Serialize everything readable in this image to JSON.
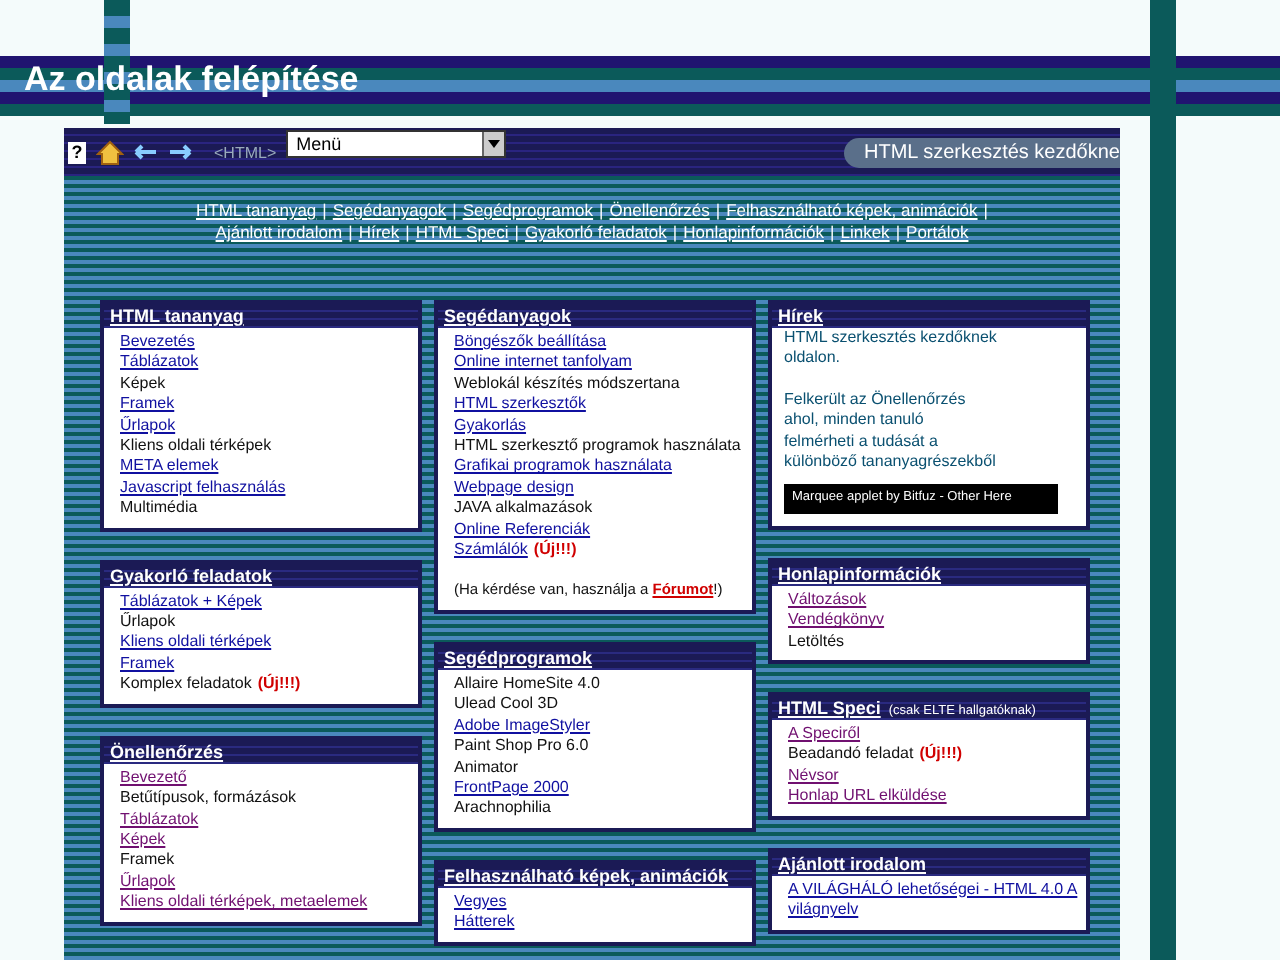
{
  "page_title": "Az oldalak felépítése",
  "toolbar": {
    "help_glyph": "?",
    "html_tag": "<HTML>",
    "menu_select": {
      "value": "Menü"
    },
    "site_title": "HTML szerkesztés kezdőkne"
  },
  "nav_separator": "|",
  "nav_lines": [
    [
      "HTML tananyag",
      "Segédanyagok",
      "Segédprogramok",
      "Önellenőrzés",
      "Felhasználható képek, animációk"
    ],
    [
      "Ajánlott irodalom",
      "Hírek",
      "HTML Speci",
      "Gyakorló feladatok",
      "Honlapinformációk",
      "Linkek",
      "Portálok"
    ]
  ],
  "columns": [
    [
      {
        "kind": "links",
        "title": "HTML tananyag",
        "visited": false,
        "items": [
          {
            "text": "Bevezetés",
            "link": true
          },
          {
            "text": "Táblázatok",
            "link": true
          },
          {
            "text": "Képek",
            "link": false
          },
          {
            "text": "Framek",
            "link": true
          },
          {
            "text": "Űrlapok",
            "link": true
          },
          {
            "text": "Kliens oldali térképek",
            "link": false
          },
          {
            "text": "META elemek",
            "link": true
          },
          {
            "text": "Javascript felhasználás",
            "link": true
          },
          {
            "text": "Multimédia",
            "link": false
          }
        ]
      },
      {
        "kind": "links",
        "title": "Gyakorló feladatok",
        "visited": false,
        "items": [
          {
            "text": "Táblázatok + Képek",
            "link": true
          },
          {
            "text": "Űrlapok",
            "link": false
          },
          {
            "text": "Kliens oldali térképek",
            "link": true
          },
          {
            "text": "Framek",
            "link": true
          },
          {
            "text": "Komplex feladatok",
            "link": false,
            "badge": "(Új!!!)"
          }
        ]
      },
      {
        "kind": "links",
        "title": "Önellenőrzés",
        "visited": true,
        "items": [
          {
            "text": "Bevezető",
            "link": true
          },
          {
            "text": "Betűtípusok, formázások",
            "link": false
          },
          {
            "text": "Táblázatok",
            "link": true
          },
          {
            "text": "Képek",
            "link": true
          },
          {
            "text": "Framek",
            "link": false
          },
          {
            "text": "Űrlapok",
            "link": true
          },
          {
            "text": "Kliens oldali térképek, metaelemek",
            "link": true
          }
        ]
      }
    ],
    [
      {
        "kind": "links",
        "title": "Segédanyagok",
        "visited": false,
        "items": [
          {
            "text": "Böngészők beállítása",
            "link": true
          },
          {
            "text": "Online internet tanfolyam",
            "link": true
          },
          {
            "text": "Weblokál készítés módszertana",
            "link": false
          },
          {
            "text": "HTML szerkesztők",
            "link": true
          },
          {
            "text": "Gyakorlás",
            "link": true
          },
          {
            "text": "HTML szerkesztő programok használata",
            "link": false
          },
          {
            "text": "Grafikai programok használata",
            "link": true
          },
          {
            "text": "Webpage design",
            "link": true
          },
          {
            "text": "JAVA alkalmazások",
            "link": false
          },
          {
            "text": "Online Referenciák",
            "link": true
          },
          {
            "text": "Számlálók",
            "link": true,
            "badge": "(Új!!!)"
          }
        ],
        "note": {
          "before": "(Ha kérdése van, használja a ",
          "link": "Fórumot",
          "after": "!)"
        }
      },
      {
        "kind": "links",
        "title": "Segédprogramok",
        "visited": false,
        "items": [
          {
            "text": "Allaire HomeSite 4.0",
            "link": false
          },
          {
            "text": "Ulead Cool 3D",
            "link": false
          },
          {
            "text": "Adobe ImageStyler",
            "link": true
          },
          {
            "text": "Paint Shop Pro 6.0",
            "link": false
          },
          {
            "text": "Animator",
            "link": false
          },
          {
            "text": "FrontPage 2000",
            "link": true
          },
          {
            "text": "Arachnophilia",
            "link": false
          }
        ]
      },
      {
        "kind": "links",
        "title": "Felhasználható képek, animációk",
        "visited": false,
        "items": [
          {
            "text": "Vegyes",
            "link": true
          },
          {
            "text": "Hátterek",
            "link": true
          }
        ]
      }
    ],
    [
      {
        "kind": "news",
        "title": "Hírek",
        "paragraphs": [
          [
            "HTML szerkesztés kezdőknek",
            "oldalon."
          ],
          [
            "Felkerült az Önellenőrzés",
            "ahol, minden tanuló",
            "felmérheti a tudását a",
            "különböző tananyagrészekből"
          ]
        ],
        "credit": "Marquee applet by Bitfuz - Other Here"
      },
      {
        "kind": "links",
        "title": "Honlapinformációk",
        "visited": true,
        "items": [
          {
            "text": "Változások",
            "link": true
          },
          {
            "text": "Vendégkönyv",
            "link": true
          },
          {
            "text": "Letöltés",
            "link": false
          }
        ]
      },
      {
        "kind": "links",
        "title": "HTML Speci",
        "subtitle": "(csak ELTE hallgatóknak)",
        "visited": true,
        "items": [
          {
            "text": "A Speciről",
            "link": true
          },
          {
            "text": "Beadandó feladat",
            "link": false,
            "badge": "(Új!!!)"
          },
          {
            "text": "Névsor",
            "link": true
          },
          {
            "text": "Honlap URL elküldése",
            "link": true
          }
        ]
      },
      {
        "kind": "links",
        "title": "Ajánlott irodalom",
        "visited": false,
        "items": [
          {
            "text": "A VILÁGHÁLÓ lehetőségei - HTML 4.0 A világnyelv",
            "link": true
          }
        ]
      }
    ]
  ]
}
